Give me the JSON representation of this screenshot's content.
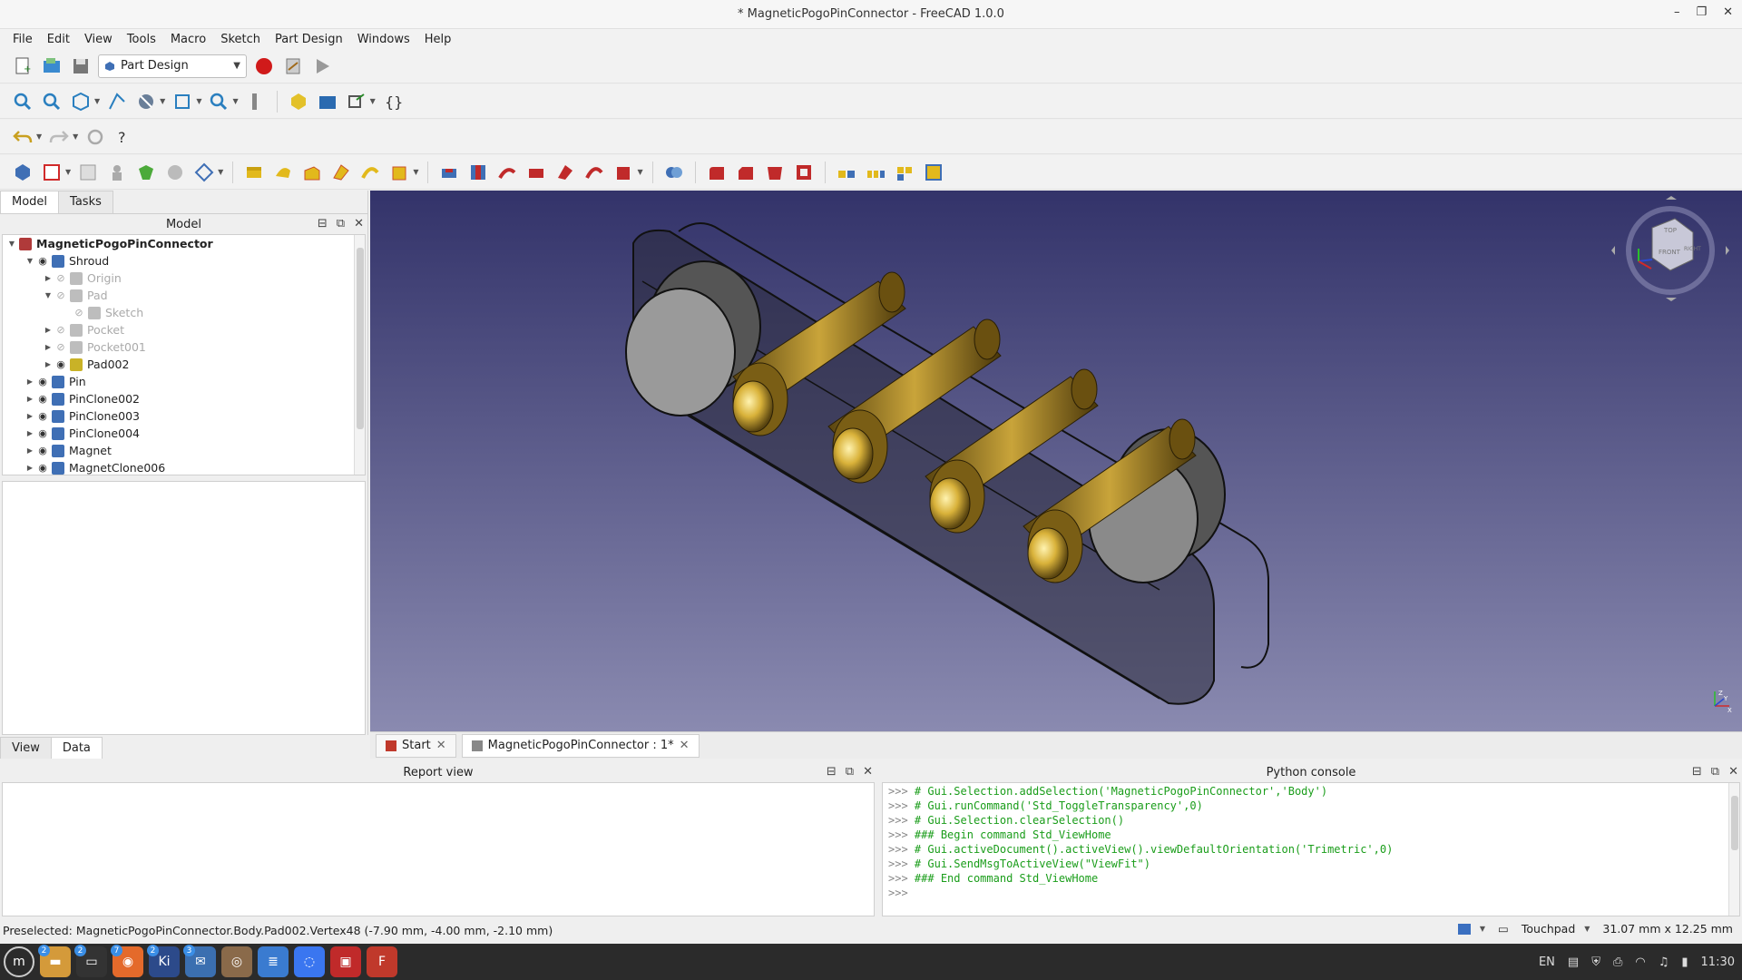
{
  "window": {
    "title": "* MagneticPogoPinConnector - FreeCAD 1.0.0",
    "minimize_glyph": "–",
    "maximize_glyph": "❐",
    "close_glyph": "✕"
  },
  "menu": [
    "File",
    "Edit",
    "View",
    "Tools",
    "Macro",
    "Sketch",
    "Part Design",
    "Windows",
    "Help"
  ],
  "workbench": {
    "selected": "Part Design"
  },
  "left_tabs": [
    "Model",
    "Tasks"
  ],
  "model_panel": {
    "title": "Model"
  },
  "tree": [
    {
      "label": "MagneticPogoPinConnector",
      "depth": 0,
      "expanded": true,
      "bold": true,
      "icon_color": "#b03a3a",
      "visible": null,
      "dim": false
    },
    {
      "label": "Shroud",
      "depth": 1,
      "expanded": true,
      "icon_color": "#3f6fb5",
      "visible": true,
      "dim": false
    },
    {
      "label": "Origin",
      "depth": 2,
      "expanded": false,
      "icon_color": "#bdbdbd",
      "visible": false,
      "dim": true
    },
    {
      "label": "Pad",
      "depth": 2,
      "expanded": true,
      "icon_color": "#bdbdbd",
      "visible": false,
      "dim": true
    },
    {
      "label": "Sketch",
      "depth": 3,
      "expanded": null,
      "icon_color": "#bdbdbd",
      "visible": false,
      "dim": true
    },
    {
      "label": "Pocket",
      "depth": 2,
      "expanded": false,
      "icon_color": "#bdbdbd",
      "visible": false,
      "dim": true
    },
    {
      "label": "Pocket001",
      "depth": 2,
      "expanded": false,
      "icon_color": "#bdbdbd",
      "visible": false,
      "dim": true
    },
    {
      "label": "Pad002",
      "depth": 2,
      "expanded": false,
      "icon_color": "#c9b227",
      "visible": true,
      "dim": false
    },
    {
      "label": "Pin",
      "depth": 1,
      "expanded": false,
      "icon_color": "#3f6fb5",
      "visible": true,
      "dim": false
    },
    {
      "label": "PinClone002",
      "depth": 1,
      "expanded": false,
      "icon_color": "#3f6fb5",
      "visible": true,
      "dim": false
    },
    {
      "label": "PinClone003",
      "depth": 1,
      "expanded": false,
      "icon_color": "#3f6fb5",
      "visible": true,
      "dim": false
    },
    {
      "label": "PinClone004",
      "depth": 1,
      "expanded": false,
      "icon_color": "#3f6fb5",
      "visible": true,
      "dim": false
    },
    {
      "label": "Magnet",
      "depth": 1,
      "expanded": false,
      "icon_color": "#3f6fb5",
      "visible": true,
      "dim": false
    },
    {
      "label": "MagnetClone006",
      "depth": 1,
      "expanded": false,
      "icon_color": "#3f6fb5",
      "visible": true,
      "dim": false
    }
  ],
  "property_tabs": [
    "View",
    "Data"
  ],
  "doc_tabs": [
    {
      "label": "Start",
      "active": false
    },
    {
      "label": "MagneticPogoPinConnector : 1*",
      "active": true
    }
  ],
  "report_view": {
    "title": "Report view"
  },
  "python_console": {
    "title": "Python console",
    "lines": [
      {
        "prompt": ">>>",
        "code": "# Gui.Selection.addSelection('MagneticPogoPinConnector','Body')"
      },
      {
        "prompt": ">>>",
        "code": "# Gui.runCommand('Std_ToggleTransparency',0)"
      },
      {
        "prompt": ">>>",
        "code": "# Gui.Selection.clearSelection()"
      },
      {
        "prompt": ">>>",
        "code": "### Begin command Std_ViewHome"
      },
      {
        "prompt": ">>>",
        "code": "# Gui.activeDocument().activeView().viewDefaultOrientation('Trimetric',0)"
      },
      {
        "prompt": ">>>",
        "code": "# Gui.SendMsgToActiveView(\"ViewFit\")"
      },
      {
        "prompt": ">>>",
        "code": "### End command Std_ViewHome"
      },
      {
        "prompt": ">>>",
        "code": ""
      }
    ]
  },
  "status": {
    "message": "Preselected: MagneticPogoPinConnector.Body.Pad002.Vertex48 (-7.90 mm, -4.00 mm, -2.10 mm)",
    "navigation": "Touchpad",
    "dimensions": "31.07 mm x 12.25 mm"
  },
  "navcube": {
    "top": "TOP",
    "front": "FRONT",
    "right": "RIGHT"
  },
  "axis_labels": {
    "x": "X",
    "y": "Y",
    "z": "Z"
  },
  "taskbar": {
    "apps": [
      {
        "name": "files",
        "badge": "2",
        "color": "#d49a3a",
        "glyph": "▬"
      },
      {
        "name": "terminal",
        "badge": "2",
        "color": "#333333",
        "glyph": "▭"
      },
      {
        "name": "firefox",
        "badge": "7",
        "color": "#e46a2b",
        "glyph": "◉"
      },
      {
        "name": "kicad",
        "badge": "2",
        "color": "#2c4a8a",
        "glyph": "Ki"
      },
      {
        "name": "mail",
        "badge": "3",
        "color": "#3b6fb0",
        "glyph": "✉"
      },
      {
        "name": "gimp",
        "badge": "",
        "color": "#8a6a4a",
        "glyph": "◎"
      },
      {
        "name": "text-editor",
        "badge": "",
        "color": "#3a7bd0",
        "glyph": "≣"
      },
      {
        "name": "signal",
        "badge": "",
        "color": "#3a76f0",
        "glyph": "◌"
      },
      {
        "name": "sql-tool",
        "badge": "",
        "color": "#c02a2a",
        "glyph": "▣"
      },
      {
        "name": "freecad",
        "badge": "",
        "color": "#c0392b",
        "glyph": "F"
      }
    ],
    "language": "EN",
    "clock": "11:30"
  }
}
